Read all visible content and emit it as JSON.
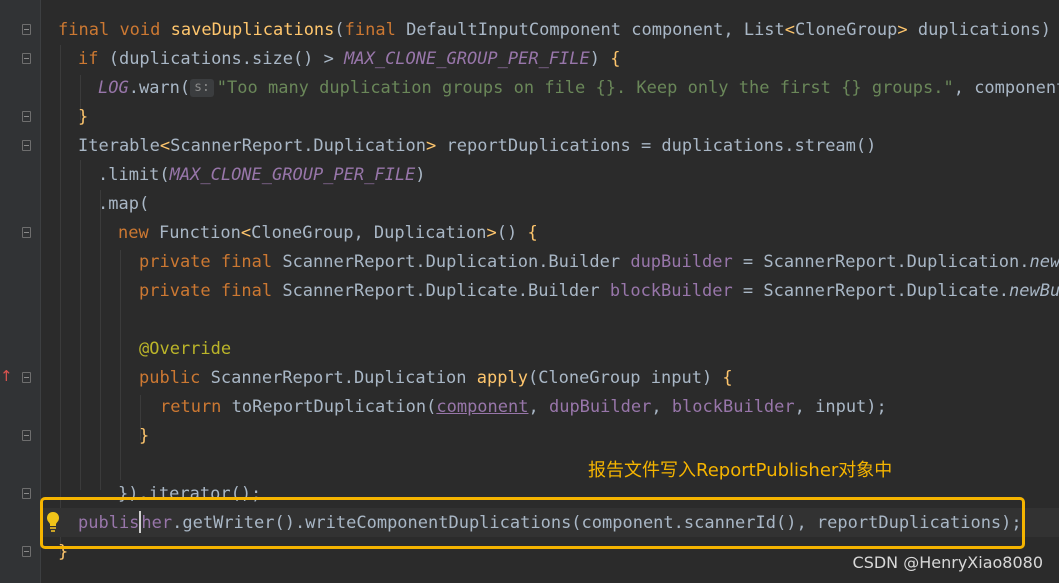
{
  "code": {
    "l1": {
      "kw1": "final",
      "kw2": "void",
      "method": "saveDuplications",
      "p1": "(",
      "kw3": "final",
      "p2": " DefaultInputComponent component, List",
      "lt": "<",
      "type": "CloneGroup",
      "gt": ">",
      "p3": " duplications) ",
      "brace": "{"
    },
    "l2": {
      "kw": "if",
      "p1": " (duplications.size() > ",
      "const": "MAX_CLONE_GROUP_PER_FILE",
      "p2": ") ",
      "brace": "{"
    },
    "l3": {
      "log": "LOG",
      "p1": ".warn(",
      "hint": "s:",
      "str": "\"Too many duplication groups on file {}. Keep only the first {} groups.\"",
      "p2": ", component"
    },
    "l4": {
      "brace": "}"
    },
    "l5": {
      "p1": "Iterable",
      "lt": "<",
      "type": "ScannerReport.Duplication",
      "gt": ">",
      "p2": " reportDuplications = duplications.stream()"
    },
    "l6": {
      "p1": ".limit(",
      "const": "MAX_CLONE_GROUP_PER_FILE",
      "p2": ")"
    },
    "l7": {
      "p1": ".map("
    },
    "l8": {
      "kw": "new",
      "p1": " Function",
      "lt": "<",
      "type": "CloneGroup, Duplication",
      "gt": ">",
      "p2": "() ",
      "brace": "{"
    },
    "l9": {
      "kw1": "private",
      "kw2": "final",
      "p1": " ScannerReport.Duplication.Builder ",
      "field": "dupBuilder",
      "p2": " = ScannerReport.Duplication.",
      "call": "newB"
    },
    "l10": {
      "kw1": "private",
      "kw2": "final",
      "p1": " ScannerReport.Duplicate.Builder ",
      "field": "blockBuilder",
      "p2": " = ScannerReport.Duplicate.",
      "call": "newBu"
    },
    "l12": {
      "ann": "@Override"
    },
    "l13": {
      "kw": "public",
      "p1": " ScannerReport.Duplication ",
      "method": "apply",
      "p2": "(CloneGroup input) ",
      "brace": "{"
    },
    "l14": {
      "kw": "return",
      "p1": " toReportDuplication(",
      "arg1": "component",
      "p2": ", ",
      "arg2": "dupBuilder",
      "p3": ", ",
      "arg3": "blockBuilder",
      "p4": ", input);"
    },
    "l15": {
      "brace": "}"
    },
    "l17": {
      "text": "}).iterator();"
    },
    "l18": {
      "field_a": "publis",
      "field_b": "her",
      "p1": ".getWriter().writeComponentDuplications(component.scannerId(), reportDuplications);"
    },
    "l19": {
      "brace": "}"
    }
  },
  "annotation": {
    "label": "报告文件写入ReportPublisher对象中",
    "color": "#f5b400"
  },
  "watermark": "CSDN @HenryXiao8080",
  "icons": {
    "intention": "lightbulb-icon",
    "override": "override-arrow-icon",
    "fold": "fold-marker-icon"
  }
}
